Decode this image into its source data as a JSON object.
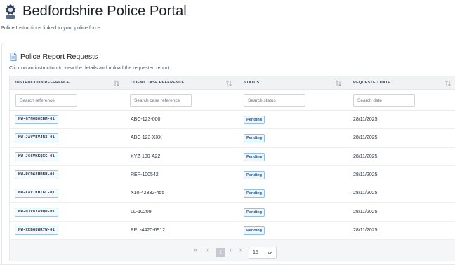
{
  "header": {
    "title": "Bedfordshire Police Portal",
    "subtitle": "Police Instructions linked to your police force",
    "logo_icon": "police-badge-icon"
  },
  "card": {
    "title": "Police Report Requests",
    "title_icon": "document-icon",
    "description": "Click on an instruction to view the details and upload the requested report."
  },
  "table": {
    "columns": [
      {
        "label": "INSTRUCTION REFERENCE",
        "filter_placeholder": "Search reference"
      },
      {
        "label": "CLIENT CASE REFERENCE",
        "filter_placeholder": "Search case reference"
      },
      {
        "label": "STATUS",
        "filter_placeholder": "Search status"
      },
      {
        "label": "REQUESTED DATE",
        "filter_placeholder": "Search date"
      }
    ],
    "rows": [
      {
        "ref": "NW-G7N6B8EBM-01",
        "client": "ABC-123-000",
        "status": "Pending",
        "date": "28/11/2025"
      },
      {
        "ref": "NW-JAVYEVJR3-01",
        "client": "ABC-123-XXX",
        "status": "Pending",
        "date": "28/11/2025"
      },
      {
        "ref": "NW-J66VKKQXG-01",
        "client": "XYZ-100-A22",
        "status": "Pending",
        "date": "28/11/2025"
      },
      {
        "ref": "NW-PCD68UDBH-01",
        "client": "REF-100542",
        "status": "Pending",
        "date": "28/11/2025"
      },
      {
        "ref": "NW-CAVTKUT6C-01",
        "client": "X10-42332-455",
        "status": "Pending",
        "date": "28/11/2025"
      },
      {
        "ref": "NW-QJV8Y49QD-01",
        "client": "LL-10209",
        "status": "Pending",
        "date": "28/11/2025"
      },
      {
        "ref": "NW-XEBG8WR7W-01",
        "client": "PPL-4420-6912",
        "status": "Pending",
        "date": "28/11/2025"
      }
    ]
  },
  "pagination": {
    "first": "«",
    "prev": "‹",
    "current_page": "1",
    "next": "›",
    "last": "»",
    "page_size": "15"
  },
  "colors": {
    "accent": "#9fc3e6",
    "status_pending": "#2a5d8f",
    "header_bg": "#f1f2f4"
  }
}
